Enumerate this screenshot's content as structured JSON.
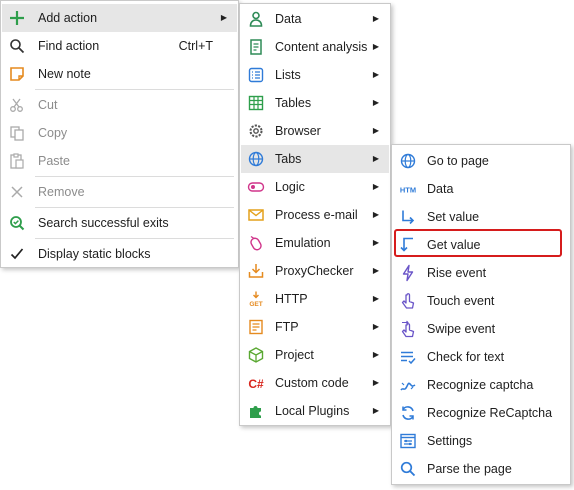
{
  "menu1": {
    "add_action": "Add action",
    "find_action": "Find action",
    "find_action_shortcut": "Ctrl+T",
    "new_note": "New note",
    "cut": "Cut",
    "copy": "Copy",
    "paste": "Paste",
    "remove": "Remove",
    "search_exits": "Search successful exits",
    "display_static": "Display static blocks"
  },
  "menu2": {
    "items": [
      "Data",
      "Content analysis",
      "Lists",
      "Tables",
      "Browser",
      "Tabs",
      "Logic",
      "Process e-mail",
      "Emulation",
      "ProxyChecker",
      "HTTP",
      "FTP",
      "Project",
      "Custom code",
      "Local Plugins"
    ]
  },
  "menu3": {
    "items": [
      "Go to page",
      "Data",
      "Set value",
      "Get value",
      "Rise event",
      "Touch event",
      "Swipe event",
      "Check for text",
      "Recognize captcha",
      "Recognize ReCaptcha",
      "Settings",
      "Parse the page"
    ]
  },
  "icon_text": {
    "http_get": "GET",
    "html": "HTM",
    "csharp": "C#"
  },
  "colors": {
    "highlight": "#e6e6e6",
    "outline": "#d61c1c",
    "accent_blue": "#2f7bd8"
  }
}
